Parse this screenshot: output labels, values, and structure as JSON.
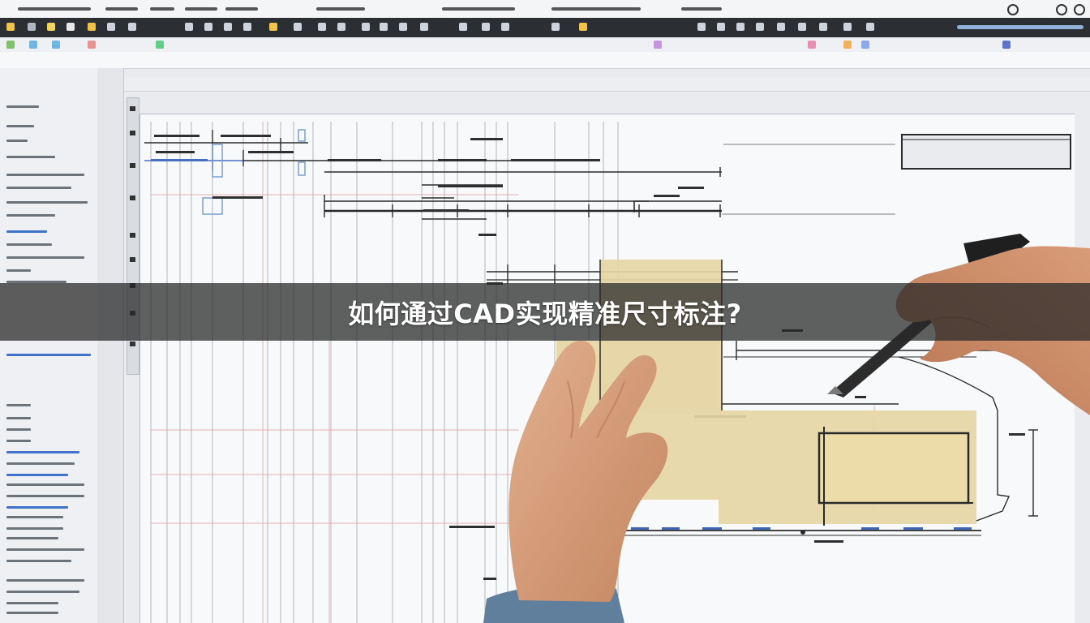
{
  "photo": {
    "subject": "hands-annotating-cad-drawing-on-screen",
    "colors": {
      "banner_bg": "#282828",
      "banner_text": "#ffffff",
      "sheet_fill": "#e6d6a6",
      "line": "#2a2a2a",
      "grid_red": "#e2a0a0",
      "skin": "#d9a07c",
      "pen": "#2c2c2c",
      "sleeve": "#5f7f9c"
    }
  },
  "banner": {
    "title": "如何通过CAD实现精准尺寸标注?"
  }
}
